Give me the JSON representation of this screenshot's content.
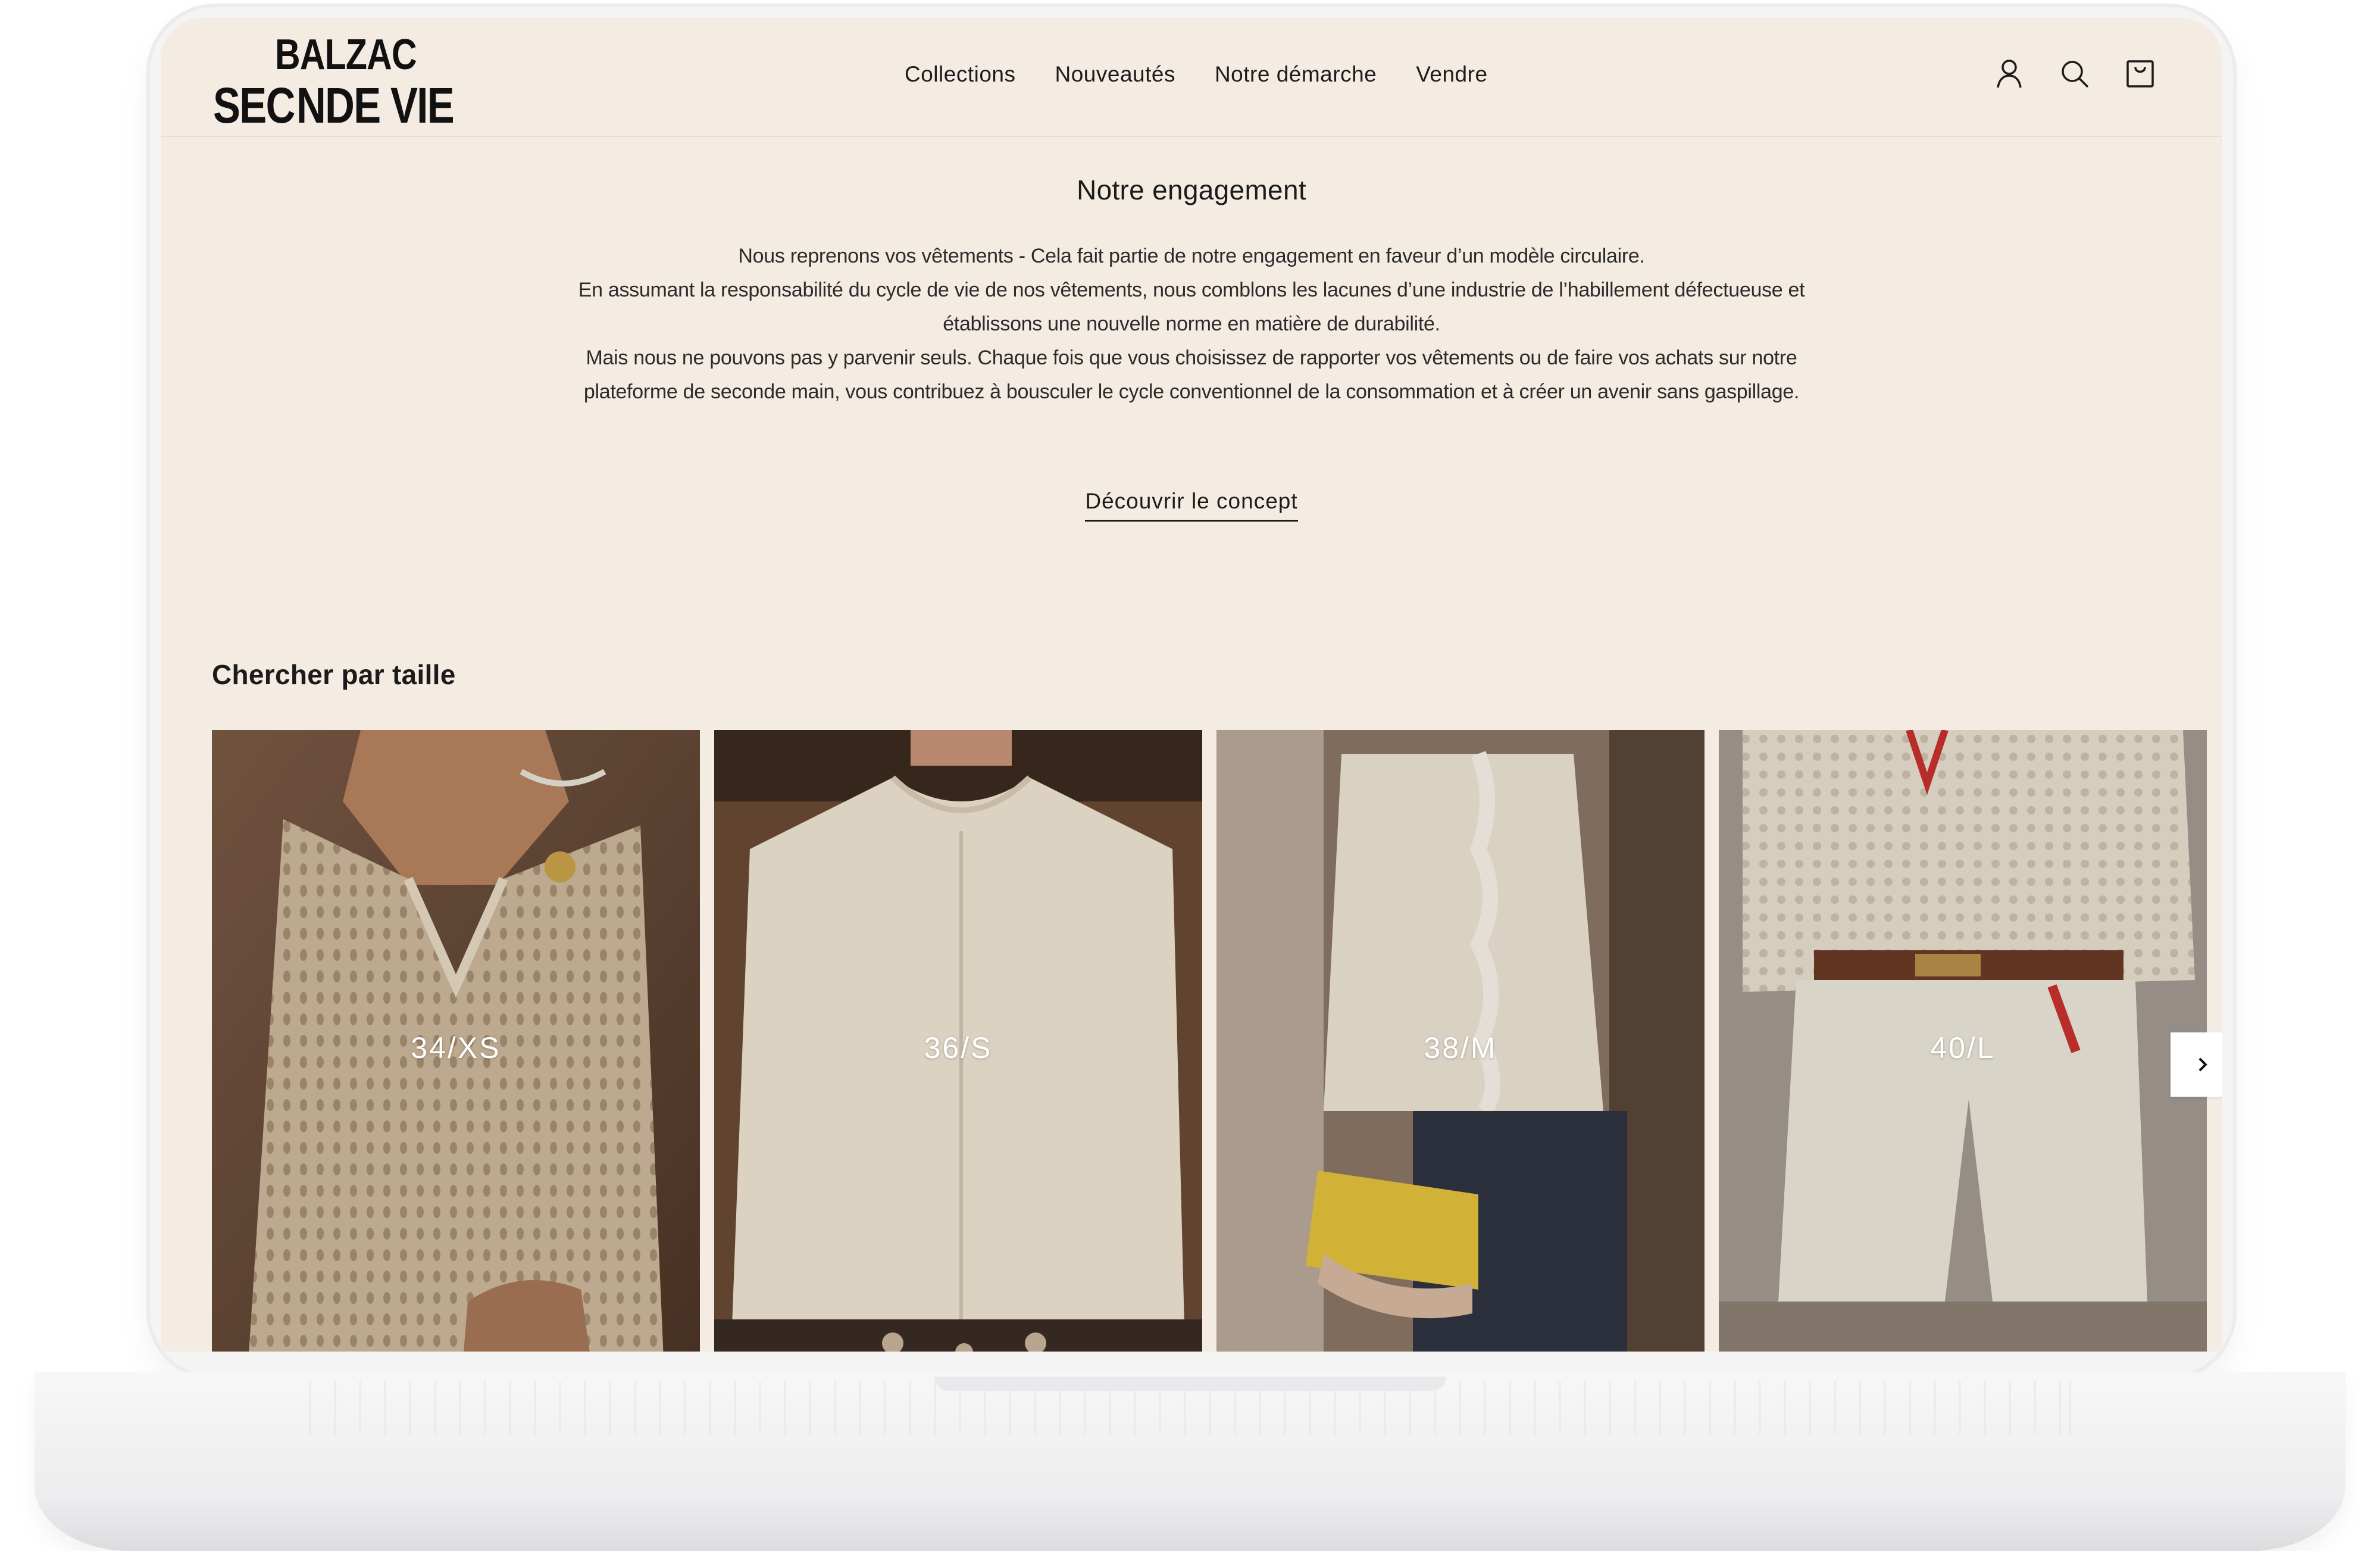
{
  "brand": {
    "line1": "BALZAC",
    "line2_a": "SEC",
    "line2_b": "NDE VIE"
  },
  "nav": {
    "items": [
      {
        "label": "Collections"
      },
      {
        "label": "Nouveautés"
      },
      {
        "label": "Notre démarche"
      },
      {
        "label": "Vendre"
      }
    ]
  },
  "header_icons": [
    "account-icon",
    "search-icon",
    "cart-icon"
  ],
  "engagement": {
    "title": "Notre engagement",
    "paragraphs": [
      "Nous reprenons vos vêtements - Cela fait partie de notre engagement en faveur d’un modèle circulaire.",
      "En assumant la responsabilité du cycle de vie de nos vêtements, nous comblons les lacunes d’une industrie de l’habillement défectueuse et établissons une nouvelle norme en matière de durabilité.",
      "Mais nous ne pouvons pas y parvenir seuls. Chaque fois que vous choisissez de rapporter vos vêtements ou de faire vos achats sur notre plateforme de seconde main, vous contribuez à bousculer le cycle conventionnel de la consommation et à créer un avenir sans gaspillage."
    ],
    "cta": "Découvrir le concept"
  },
  "sizes": {
    "title": "Chercher par taille",
    "cards": [
      {
        "label": "34/XS"
      },
      {
        "label": "36/S"
      },
      {
        "label": "38/M"
      },
      {
        "label": "40/L"
      }
    ],
    "next_icon": "chevron-right-icon"
  },
  "colors": {
    "background": "#f4ebe3",
    "text": "#1b1b1b",
    "divider": "#e8ddd2"
  }
}
